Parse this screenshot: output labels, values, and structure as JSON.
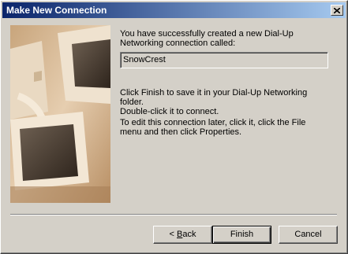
{
  "window": {
    "title": "Make New Connection"
  },
  "illustration": {
    "icon": "computer-monitors-illustration"
  },
  "message": {
    "success": "You have successfully created a new Dial-Up Networking connection called:",
    "connection_name": "SnowCrest",
    "finish_info_line1": "Click Finish to save it in your Dial-Up Networking folder.",
    "finish_info_line2": "Double-click it to connect.",
    "edit_info": "To edit this connection later, click it, click the File menu and then click Properties."
  },
  "buttons": {
    "back_prefix": "< ",
    "back_accel": "B",
    "back_rest": "ack",
    "finish": "Finish",
    "cancel": "Cancel"
  }
}
